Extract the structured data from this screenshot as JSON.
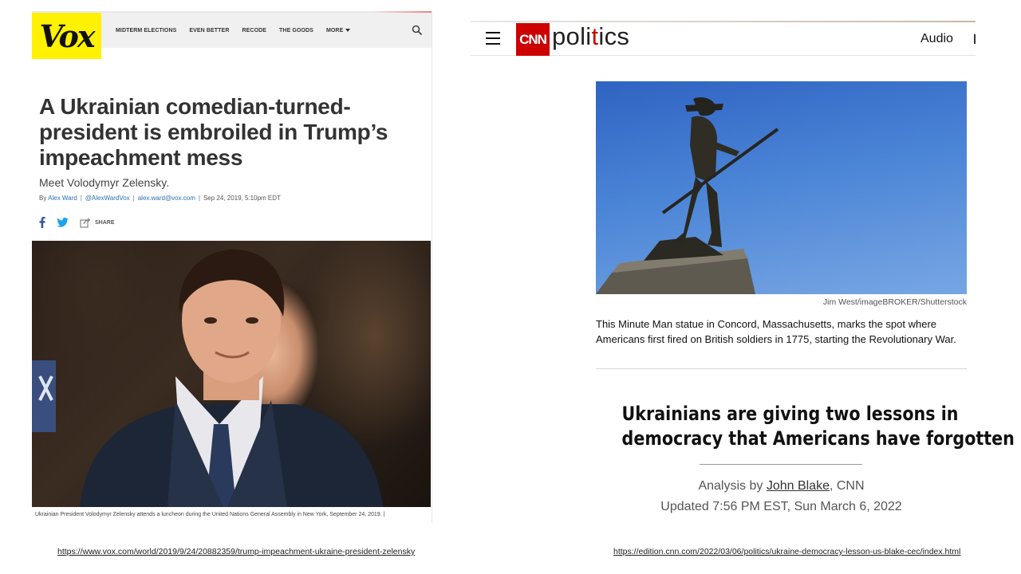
{
  "vox": {
    "logo": "Vox",
    "nav": [
      "MIDTERM ELECTIONS",
      "EVEN BETTER",
      "RECODE",
      "THE GOODS",
      "MORE"
    ],
    "title": "A Ukrainian comedian-turned-president is embroiled in Trump’s impeachment mess",
    "dek": "Meet Volodymyr Zelensky.",
    "byline": {
      "prefix": "By",
      "author": "Alex Ward",
      "twitter": "@AlexWardVox",
      "email": "alex.ward@vox.com",
      "date": "Sep 24, 2019, 5:10pm EDT"
    },
    "share_label": "SHARE",
    "caption": "Ukrainian President Volodymyr Zelensky attends a luncheon during the United Nations General Assembly in New York, September 24, 2019.  |",
    "url": "https://www.vox.com/world/2019/9/24/20882359/trump-impeachment-ukraine-president-zelensky"
  },
  "cnn": {
    "logo": "CNN",
    "section": {
      "before": "poli",
      "dot": "t",
      "after": "ics"
    },
    "audio": "Audio",
    "photo_credit": "Jim West/imageBROKER/Shutterstock",
    "photo_caption": "This Minute Man statue in Concord, Massachusetts, marks the spot where Americans first fired on British soldiers in 1775, starting the Revolutionary War.",
    "headline_line1": "Ukrainians are giving two lessons in",
    "headline_line2": "democracy that Americans have forgotten",
    "byline_prefix": "Analysis by",
    "author": "John Blake",
    "byline_suffix": ", CNN",
    "updated": "Updated 7:56 PM EST, Sun March 6, 2022",
    "url": "https://edition.cnn.com/2022/03/06/politics/ukraine-democracy-lesson-us-blake-cec/index.html"
  },
  "colors": {
    "vox_yellow": "#fff200",
    "cnn_red": "#cc0000",
    "link_blue": "#2a6fb0"
  }
}
